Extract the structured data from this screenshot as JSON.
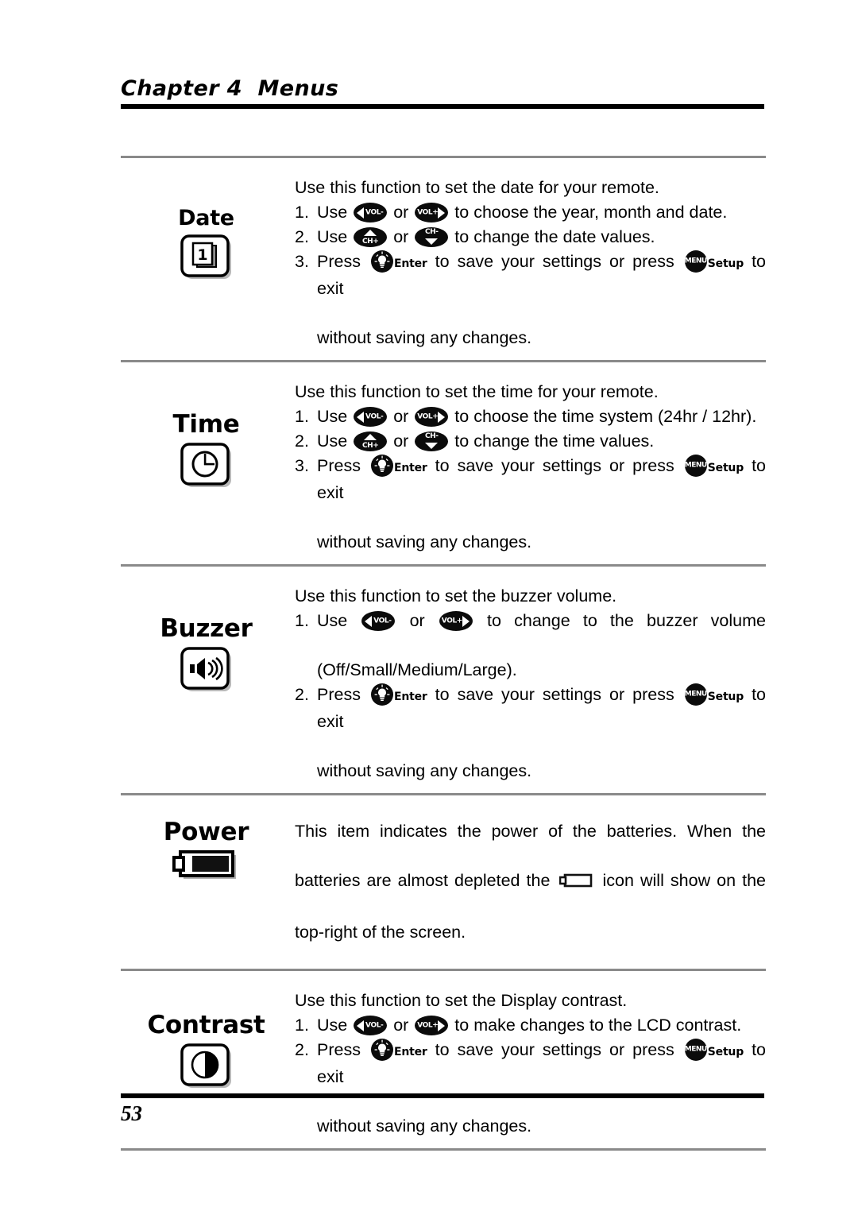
{
  "header": {
    "chapter_title": "Chapter 4  Menus"
  },
  "footer": {
    "page_number": "53"
  },
  "buttons": {
    "vol_minus_label": "VOL-",
    "vol_plus_label": "VOL+",
    "ch_plus_label": "CH+",
    "ch_minus_label": "CH-",
    "menu_label": "MENU",
    "enter_caption": "Enter",
    "setup_caption": "Setup"
  },
  "sections": [
    {
      "label": "Date",
      "icon": "calendar-icon",
      "intro": "Use this function to set the date for your remote.",
      "steps": [
        {
          "num": "1.",
          "pre": "Use",
          "btn_a": "vol-minus-button",
          "mid": "or",
          "btn_b": "vol-plus-button",
          "post": "to choose the year, month and date."
        },
        {
          "num": "2.",
          "pre": "Use",
          "btn_a": "ch-plus-button",
          "mid": "or",
          "btn_b": "ch-minus-button",
          "post": "to change the date values."
        },
        {
          "num": "3.",
          "pre": "Press",
          "btn_a": "enter-button",
          "mid": "to save your settings or press",
          "btn_b": "setup-button",
          "post": "to exit",
          "cont": "without saving any changes."
        }
      ]
    },
    {
      "label": "Time",
      "icon": "clock-icon",
      "intro": "Use this function to set the time for your remote.",
      "steps": [
        {
          "num": "1.",
          "pre": "Use",
          "btn_a": "vol-minus-button",
          "mid": "or",
          "btn_b": "vol-plus-button",
          "post": "to choose the time system (24hr / 12hr)."
        },
        {
          "num": "2.",
          "pre": "Use",
          "btn_a": "ch-plus-button",
          "mid": "or",
          "btn_b": "ch-minus-button",
          "post": "to change the time values."
        },
        {
          "num": "3.",
          "pre": "Press",
          "btn_a": "enter-button",
          "mid": "to save your settings or press",
          "btn_b": "setup-button",
          "post": "to exit",
          "cont": "without saving any changes."
        }
      ]
    },
    {
      "label": "Buzzer",
      "icon": "speaker-icon",
      "intro": "Use this function to set the buzzer volume.",
      "steps": [
        {
          "num": "1.",
          "pre": "Use",
          "btn_a": "vol-minus-button",
          "mid": "or",
          "btn_b": "vol-plus-button",
          "post": "to change to the buzzer volume",
          "cont": "(Off/Small/Medium/Large)."
        },
        {
          "num": "2.",
          "pre": "Press",
          "btn_a": "enter-button",
          "mid": "to save your settings or press",
          "btn_b": "setup-button",
          "post": "to exit",
          "cont": "without saving any changes."
        }
      ]
    },
    {
      "label": "Power",
      "icon": "battery-full-icon",
      "paragraph_a": "This item indicates the power of the batteries. When the",
      "paragraph_b_pre": "batteries are almost depleted the",
      "paragraph_b_icon": "battery-empty-icon",
      "paragraph_b_post": "icon will show on the",
      "paragraph_c": "top-right of the screen."
    },
    {
      "label": "Contrast",
      "icon": "contrast-icon",
      "intro": "Use this function to set the Display contrast.",
      "steps": [
        {
          "num": "1.",
          "pre": "Use",
          "btn_a": "vol-minus-button",
          "mid": "or",
          "btn_b": "vol-plus-button",
          "post": "to make changes to the LCD contrast."
        },
        {
          "num": "2.",
          "pre": "Press",
          "btn_a": "enter-button",
          "mid": "to save your settings or press",
          "btn_b": "setup-button",
          "post": "to exit",
          "cont": "without saving any changes."
        }
      ]
    }
  ],
  "colors": {
    "rule_black": "#000000",
    "divider_gray": "#8a8a8a",
    "button_black": "#0b0b0b",
    "text_black": "#000000"
  }
}
